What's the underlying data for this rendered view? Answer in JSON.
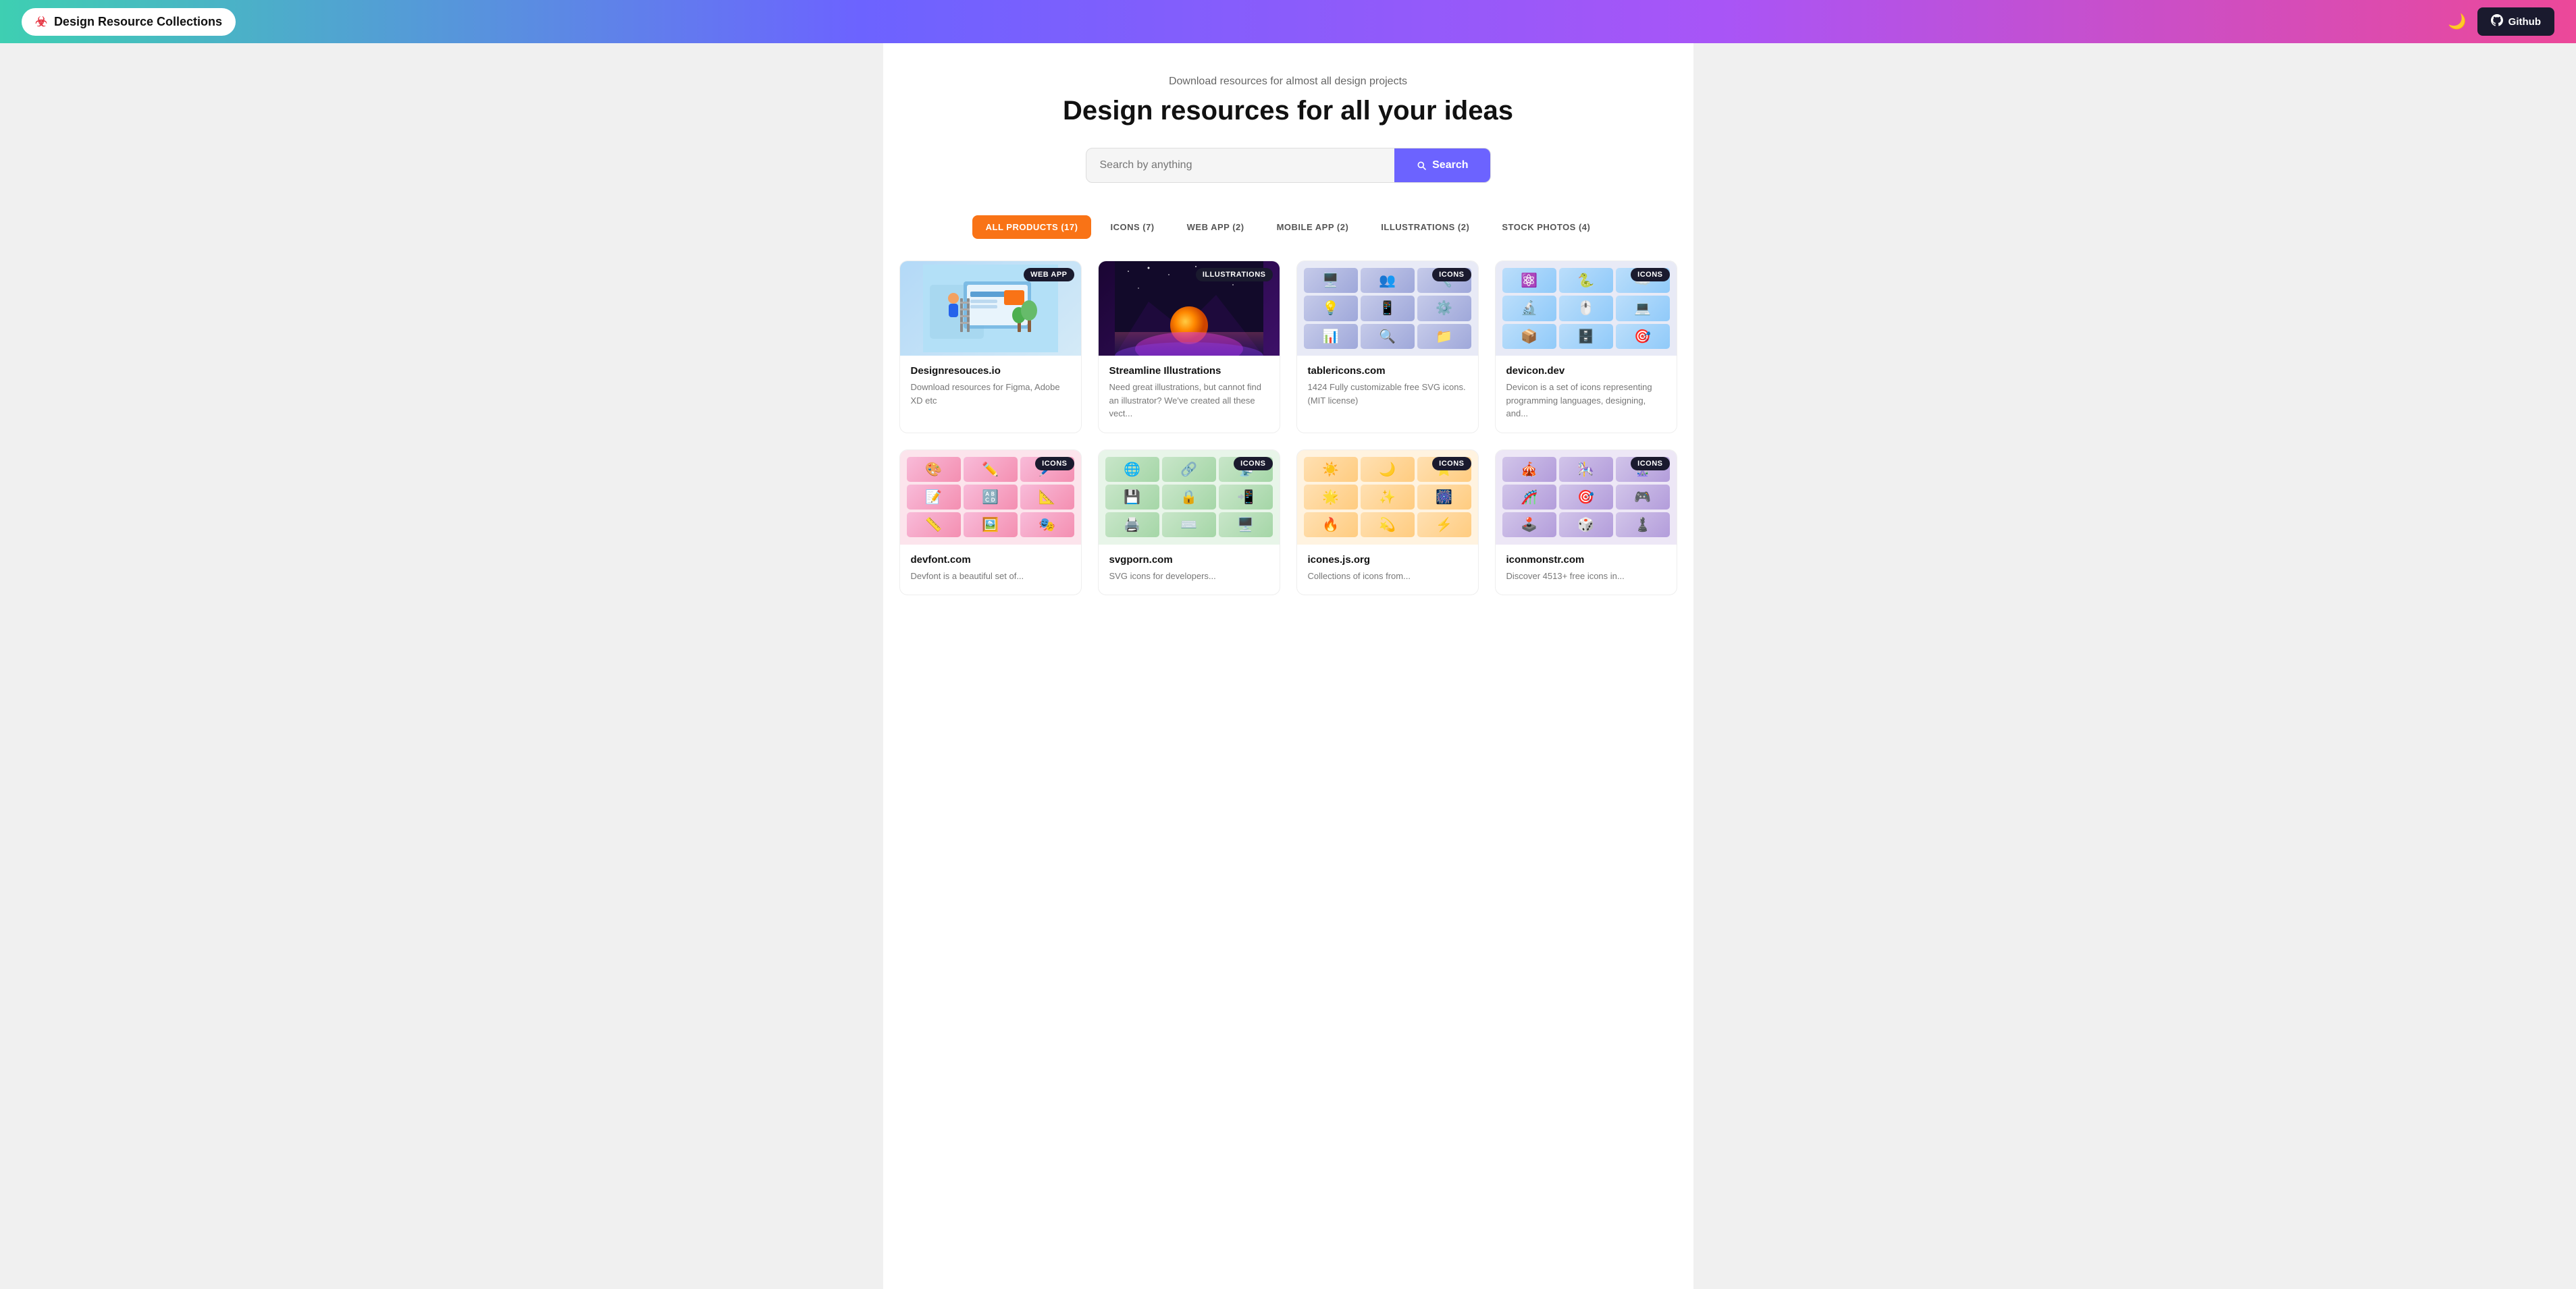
{
  "navbar": {
    "brand_label": "Design Resource Collections",
    "biohazard_symbol": "☣",
    "moon_symbol": "🌙",
    "github_label": "Github",
    "github_icon": "⚙"
  },
  "hero": {
    "subtitle": "Download resources for almost all design projects",
    "title": "Design resources for all your ideas"
  },
  "search": {
    "placeholder": "Search by anything",
    "button_label": "Search"
  },
  "filter_tabs": [
    {
      "label": "ALL PRODUCTS (17)",
      "active": true
    },
    {
      "label": "ICONS (7)",
      "active": false
    },
    {
      "label": "WEB APP (2)",
      "active": false
    },
    {
      "label": "MOBILE APP (2)",
      "active": false
    },
    {
      "label": "ILLUSTRATIONS (2)",
      "active": false
    },
    {
      "label": "STOCK PHOTOS (4)",
      "active": false
    }
  ],
  "cards": [
    {
      "id": "designresouces",
      "badge": "WEB APP",
      "type": "webapp",
      "title": "Designresouces.io",
      "description": "Download resources for Figma, Adobe XD etc"
    },
    {
      "id": "streamline",
      "badge": "ILLUSTRATIONS",
      "type": "illustration",
      "title": "Streamline Illustrations",
      "description": "Need great illustrations, but cannot find an illustrator? We've created all these vect..."
    },
    {
      "id": "tablericons",
      "badge": "ICONS",
      "type": "icons",
      "title": "tablericons.com",
      "description": "1424 Fully customizable free SVG icons. (MIT license)"
    },
    {
      "id": "devicon",
      "badge": "ICONS",
      "type": "icons",
      "title": "devicon.dev",
      "description": "Devicon is a set of icons representing programming languages, designing, and..."
    },
    {
      "id": "devfont",
      "badge": "ICONS",
      "type": "icons",
      "title": "devfont.com",
      "description": "Devfont is a beautiful set of..."
    },
    {
      "id": "svgporn",
      "badge": "ICONS",
      "type": "icons",
      "title": "svgporn.com",
      "description": "SVG icons for developers..."
    },
    {
      "id": "iconesjs",
      "badge": "ICONS",
      "type": "icons",
      "title": "icones.js.org",
      "description": "Collections of icons from..."
    },
    {
      "id": "iconmonstr",
      "badge": "ICONS",
      "type": "icons",
      "title": "iconmonstr.com",
      "description": "Discover 4513+ free icons in..."
    }
  ],
  "icon_emojis": [
    "🖥️",
    "👥",
    "🔧",
    "💡",
    "📱",
    "⚙️",
    "📊",
    "🔍",
    "📁"
  ]
}
